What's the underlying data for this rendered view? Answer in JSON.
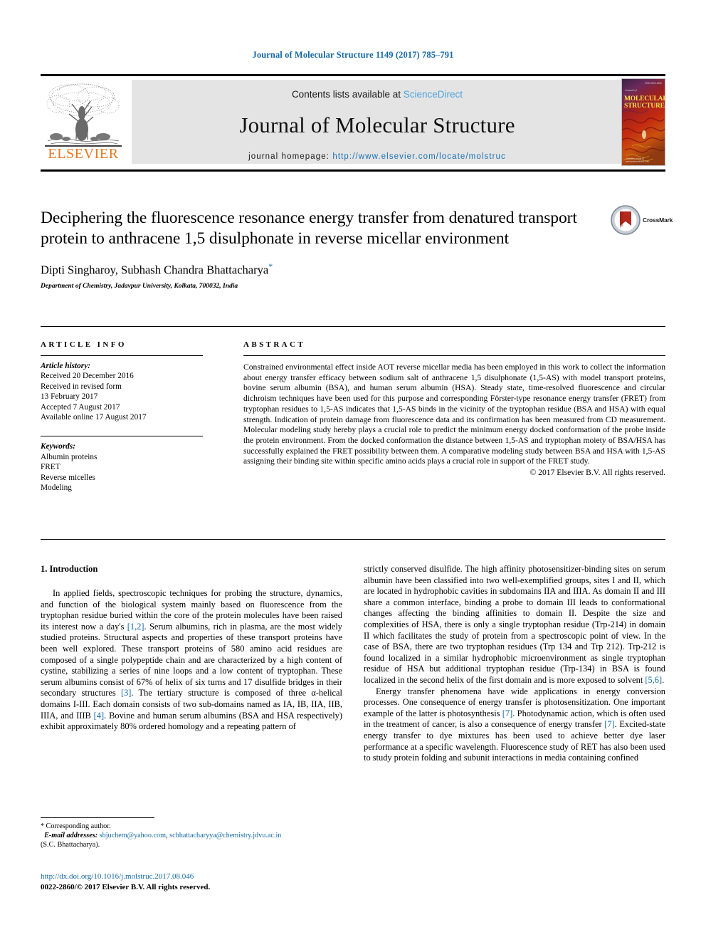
{
  "running_head": "Journal of Molecular Structure 1149 (2017) 785–791",
  "masthead": {
    "contents_prefix": "Contents lists available at ",
    "sciencedirect": "ScienceDirect",
    "journal_name": "Journal of Molecular Structure",
    "homepage_prefix": "journal homepage: ",
    "homepage_url": "http://www.elsevier.com/locate/molstruc",
    "publisher": "ELSEVIER",
    "cover": {
      "title_line1": "MOLECULAR",
      "title_line2": "STRUCTURE",
      "masthead_small": "Journal of",
      "top_small": "ISSN 0022-2860",
      "bottom_small": "Available online at www.sciencedirect.com"
    },
    "accent_link_color": "#4aa3df",
    "brand_color": "#e87722"
  },
  "article": {
    "title": "Deciphering the fluorescence resonance energy transfer from denatured transport protein to anthracene 1,5 disulphonate in reverse micellar environment",
    "authors": "Dipti Singharoy, Subhash Chandra Bhattacharya",
    "corresponding_marker": "*",
    "affiliation": "Department of Chemistry, Jadavpur University, Kolkata, 700032, India",
    "crossmark_label": "CrossMark"
  },
  "article_info": {
    "heading": "ARTICLE INFO",
    "history_label": "Article history:",
    "history": [
      "Received 20 December 2016",
      "Received in revised form",
      "13 February 2017",
      "Accepted 7 August 2017",
      "Available online 17 August 2017"
    ],
    "keywords_label": "Keywords:",
    "keywords": [
      "Albumin proteins",
      "FRET",
      "Reverse micelles",
      "Modeling"
    ]
  },
  "abstract": {
    "heading": "ABSTRACT",
    "text": "Constrained environmental effect inside AOT reverse micellar media has been employed in this work to collect the information about energy transfer efficacy between sodium salt of anthracene 1,5 disulphonate (1,5-AS) with model transport proteins, bovine serum albumin (BSA), and human serum albumin (HSA). Steady state, time-resolved fluorescence and circular dichroism techniques have been used for this purpose and corresponding Förster-type resonance energy transfer (FRET) from tryptophan residues to 1,5-AS indicates that 1,5-AS binds in the vicinity of the tryptophan residue (BSA and HSA) with equal strength. Indication of protein damage from fluorescence data and its confirmation has been measured from CD measurement. Molecular modeling study hereby plays a crucial role to predict the minimum energy docked conformation of the probe inside the protein environment. From the docked conformation the distance between 1,5-AS and tryptophan moiety of BSA/HSA has successfully explained the FRET possibility between them. A comparative modeling study between BSA and HSA with 1,5-AS assigning their binding site within specific amino acids plays a crucial role in support of the FRET study.",
    "copyright": "© 2017 Elsevier B.V. All rights reserved."
  },
  "body": {
    "section_number_title": "1. Introduction",
    "left_para_1_a": "In applied fields, spectroscopic techniques for probing the structure, dynamics, and function of the biological system mainly based on fluorescence from the tryptophan residue buried within the core of the protein molecules have been raised its interest now a day's ",
    "left_ref_1": "[1,2]",
    "left_para_1_b": ". Serum albumins, rich in plasma, are the most widely studied proteins. Structural aspects and properties of these transport proteins have been well explored. These transport proteins of 580 amino acid residues are composed of a single polypeptide chain and are characterized by a high content of cystine, stabilizing a series of nine loops and a low content of tryptophan. These serum albumins consist of 67% of helix of six turns and 17 disulfide bridges in their secondary structures ",
    "left_ref_2": "[3]",
    "left_para_1_c": ". The tertiary structure is composed of three α-helical domains I-III. Each domain consists of two sub-domains named as IA, IB, IIA, IIB, IIIA, and IIIB ",
    "left_ref_3": "[4]",
    "left_para_1_d": ". Bovine and human serum albumins (BSA and HSA respectively) exhibit approximately 80% ordered homology and a repeating pattern of",
    "right_para_1_a": "strictly conserved disulfide. The high affinity photosensitizer-binding sites on serum albumin have been classified into two well-exemplified groups, sites I and II, which are located in hydrophobic cavities in subdomains IIA and IIIA. As domain II and III share a common interface, binding a probe to domain III leads to conformational changes affecting the binding affinities to domain II. Despite the size and complexities of HSA, there is only a single tryptophan residue (Trp-214) in domain II which facilitates the study of protein from a spectroscopic point of view. In the case of BSA, there are two tryptophan residues (Trp 134 and Trp 212). Trp-212 is found localized in a similar hydrophobic microenvironment as single tryptophan residue of HSA but additional tryptophan residue (Trp-134) in BSA is found localized in the second helix of the first domain and is more exposed to solvent ",
    "right_ref_1": "[5,6]",
    "right_para_1_b": ".",
    "right_para_2_a": "Energy transfer phenomena have wide applications in energy conversion processes. One consequence of energy transfer is photosensitization. One important example of the latter is photosynthesis ",
    "right_ref_2": "[7]",
    "right_para_2_b": ". Photodynamic action, which is often used in the treatment of cancer, is also a consequence of energy transfer ",
    "right_ref_3": "[7]",
    "right_para_2_c": ". Excited-state energy transfer to dye mixtures has been used to achieve better dye laser performance at a specific wavelength. Fluorescence study of RET has also been used to study protein folding and subunit interactions in media containing confined"
  },
  "footer": {
    "corresponding_marker": "*",
    "corresponding_author": "Corresponding author.",
    "email_label": "E-mail addresses:",
    "email_1": "sbjuchem@yahoo.com",
    "email_sep": ", ",
    "email_2": "scbhattacharyya@chemistry.jdvu.ac.in",
    "email_attribution": "(S.C. Bhattacharya).",
    "doi_url": "http://dx.doi.org/10.1016/j.molstruc.2017.08.046",
    "issn_line": "0022-2860/© 2017 Elsevier B.V. All rights reserved."
  }
}
